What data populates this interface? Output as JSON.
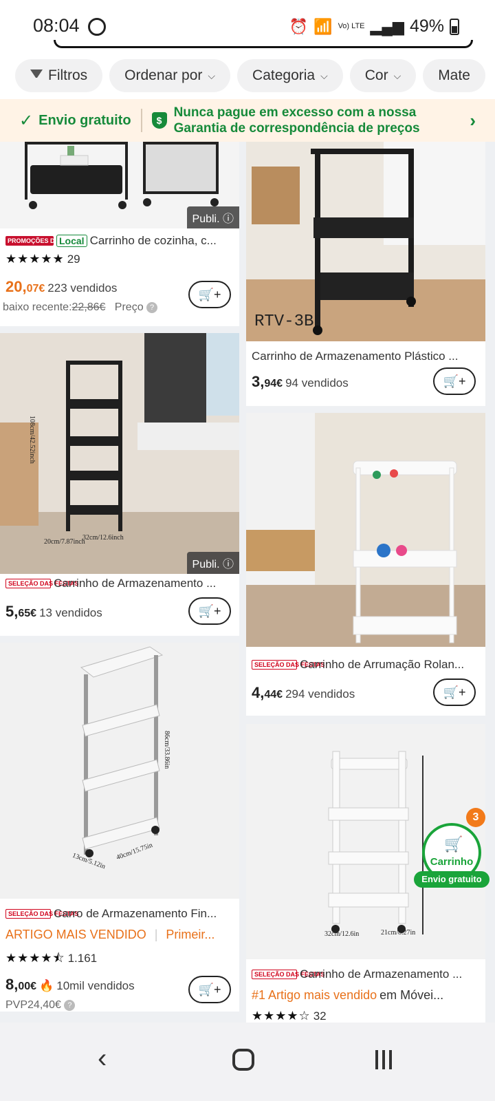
{
  "status": {
    "time": "08:04",
    "battery": "49%",
    "network": "Vo) LTE"
  },
  "filters": [
    {
      "label": "Filtros",
      "icon": "filter-icon"
    },
    {
      "label": "Ordenar por"
    },
    {
      "label": "Categoria"
    },
    {
      "label": "Cor"
    },
    {
      "label": "Mate"
    }
  ],
  "banner": {
    "shipping": "Envio gratuito",
    "guarantee_line1": "Nunca pague em excesso com a nossa",
    "guarantee_line2": "Garantia de correspondência de preços"
  },
  "products": {
    "p1": {
      "promo_badge": "PROMOÇÕES DAS FESTAS",
      "local_badge": "Local",
      "title": "Carrinho de cozinha, c...",
      "stars": "★★★★★",
      "reviews": "29",
      "price_int": "20,",
      "price_dec": "07€",
      "sold": "223 vendidos",
      "old_price_label": "baixo recente:",
      "old_price": "22,86€",
      "price_hint": "Preço",
      "ad": "Publi. ⓘ"
    },
    "p2": {
      "img_text": "RTV-3B",
      "title": "Carrinho de Armazenamento Plástico ...",
      "price_int": "3,",
      "price_dec": "94€",
      "sold": "94 vendidos"
    },
    "p3": {
      "sel_badge": "SELEÇÃO DAS FESTAS",
      "title": "Carrinho de Armazenamento ...",
      "price_int": "5,",
      "price_dec": "65€",
      "sold": "13 vendidos",
      "ad": "Publi. ⓘ"
    },
    "p4": {
      "sel_badge": "SELEÇÃO DAS FESTAS",
      "title": "Carrinho de Arrumação Rolan...",
      "price_int": "4,",
      "price_dec": "44€",
      "sold": "294 vendidos"
    },
    "p5": {
      "sel_badge": "SELEÇÃO DAS FESTAS",
      "title": "Carro de Armazenamento Fin...",
      "bestseller": "ARTIGO MAIS VENDIDO",
      "first": "Primeir...",
      "stars": "★★★★⯪",
      "reviews": "1.161",
      "price_int": "8,",
      "price_dec": "00€",
      "sold": "10mil vendidos",
      "rrp": "PVP24,40€"
    },
    "p6": {
      "sel_badge": "SELEÇÃO DAS FESTAS",
      "title": "Carrinho de Armazenamento ...",
      "rank": "#1 Artigo mais vendido",
      "rank_suffix": "em Móvei...",
      "stars": "★★★★☆",
      "reviews": "32"
    }
  },
  "floating_cart": {
    "label": "Carrinho",
    "count": "3",
    "shipping": "Envio gratuito"
  },
  "dims": {
    "p3_h": "108cm/42.52inch",
    "p3_w": "32cm/12.6inch",
    "p3_d": "20cm/7.87inch",
    "p5_h": "86cm/33.86in",
    "p5_w": "40cm/15.75in",
    "p5_d": "13cm/5.12in",
    "p6_w": "32cm/12.6in",
    "p6_d": "21cm/8.27in"
  },
  "colors": {
    "accent_orange": "#e8711a",
    "green": "#168a3a",
    "red": "#d0021b"
  }
}
